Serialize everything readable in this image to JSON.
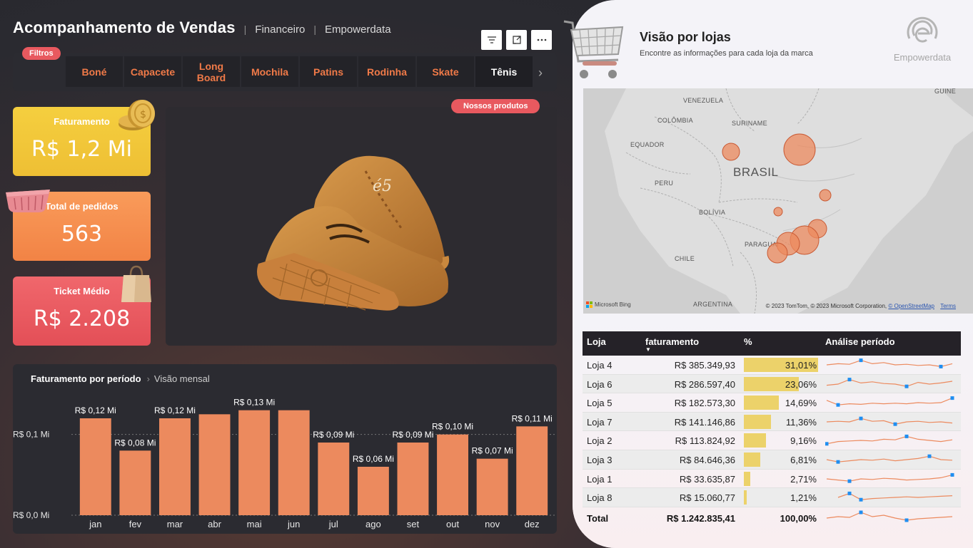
{
  "header": {
    "title": "Acompanhamento de Vendas",
    "crumbs": [
      "Financeiro",
      "Empowerdata"
    ]
  },
  "filters": {
    "badge": "Filtros",
    "items": [
      "Boné",
      "Capacete",
      "Long Board",
      "Mochila",
      "Patins",
      "Rodinha",
      "Skate",
      "Tênis"
    ],
    "selected": "Tênis"
  },
  "kpis": {
    "faturamento": {
      "label": "Faturamento",
      "value": "R$ 1,2 Mi"
    },
    "pedidos": {
      "label": "Total de pedidos",
      "value": "563"
    },
    "ticket": {
      "label": "Ticket Médio",
      "value": "R$ 2.208"
    }
  },
  "products": {
    "badge": "Nossos produtos"
  },
  "chart_title": {
    "title": "Faturamento por período",
    "subtitle": "Visão mensal"
  },
  "chart_data": {
    "type": "bar",
    "categories": [
      "jan",
      "fev",
      "mar",
      "abr",
      "mai",
      "jun",
      "jul",
      "ago",
      "set",
      "out",
      "nov",
      "dez"
    ],
    "values": [
      0.12,
      0.08,
      0.12,
      0.125,
      0.13,
      0.13,
      0.09,
      0.06,
      0.09,
      0.1,
      0.07,
      0.11
    ],
    "data_labels": [
      "R$ 0,12 Mi",
      "R$ 0,08 Mi",
      "R$ 0,12 Mi",
      "",
      "R$ 0,13 Mi",
      "",
      "R$ 0,09 Mi",
      "R$ 0,06 Mi",
      "R$ 0,09 Mi",
      "R$ 0,10 Mi",
      "R$ 0,07 Mi",
      "R$ 0,11 Mi"
    ],
    "y_ticks": [
      {
        "value": 0,
        "label": "R$ 0,0 Mi"
      },
      {
        "value": 0.1,
        "label": "R$ 0,1 Mi"
      }
    ],
    "ylim": [
      0,
      0.135
    ],
    "color": "#ec8a5e",
    "grid": true
  },
  "right": {
    "title": "Visão por lojas",
    "subtitle": "Encontre as informações para cada loja da marca",
    "brand": "Empowerdata"
  },
  "map": {
    "labels": [
      "VENEZUELA",
      "GUINE",
      "COLÔMBIA",
      "SURINAME",
      "EQUADOR",
      "BRASIL",
      "PERU",
      "BOLÍVIA",
      "PARAGUAI",
      "CHILE",
      "ARGENTINA"
    ],
    "credit": "© 2023 TomTom, © 2023 Microsoft Corporation,",
    "osm": "© OpenStreetMap",
    "terms": "Terms",
    "bing": "Microsoft Bing"
  },
  "table": {
    "headers": {
      "loja": "Loja",
      "faturamento": "faturamento",
      "pct": "%",
      "analise": "Análise período"
    },
    "rows": [
      {
        "loja": "Loja 4",
        "faturamento": "R$ 385.349,93",
        "pct": "31,01%",
        "share": 0.3101,
        "trend": [
          0.5,
          0.6,
          0.55,
          0.9,
          0.6,
          0.7,
          0.5,
          0.55,
          0.45,
          0.5,
          0.35,
          0.6
        ]
      },
      {
        "loja": "Loja 6",
        "faturamento": "R$ 286.597,40",
        "pct": "23,06%",
        "share": 0.2306,
        "trend": [
          0.4,
          0.5,
          0.9,
          0.6,
          0.7,
          0.55,
          0.5,
          0.3,
          0.65,
          0.5,
          0.6,
          0.75
        ]
      },
      {
        "loja": "Loja 5",
        "faturamento": "R$ 182.573,30",
        "pct": "14,69%",
        "share": 0.1469,
        "trend": [
          0.7,
          0.3,
          0.4,
          0.35,
          0.45,
          0.4,
          0.45,
          0.4,
          0.5,
          0.45,
          0.5,
          0.9
        ]
      },
      {
        "loja": "Loja 7",
        "faturamento": "R$ 141.146,86",
        "pct": "11,36%",
        "share": 0.1136,
        "trend": [
          0.5,
          0.55,
          0.5,
          0.8,
          0.55,
          0.6,
          0.3,
          0.5,
          0.55,
          0.45,
          0.5,
          0.4
        ]
      },
      {
        "loja": "Loja 2",
        "faturamento": "R$ 113.824,92",
        "pct": "9,16%",
        "share": 0.0916,
        "trend": [
          0.2,
          0.4,
          0.45,
          0.5,
          0.45,
          0.6,
          0.55,
          0.85,
          0.6,
          0.5,
          0.4,
          0.55
        ]
      },
      {
        "loja": "Loja 3",
        "faturamento": "R$ 84.646,36",
        "pct": "6,81%",
        "share": 0.0681,
        "trend": [
          0.5,
          0.3,
          0.4,
          0.5,
          0.45,
          0.55,
          0.4,
          0.5,
          0.6,
          0.8,
          0.5,
          0.45
        ]
      },
      {
        "loja": "Loja 1",
        "faturamento": "R$ 33.635,87",
        "pct": "2,71%",
        "share": 0.0271,
        "trend": [
          0.5,
          0.4,
          0.3,
          0.5,
          0.45,
          0.55,
          0.5,
          0.4,
          0.45,
          0.5,
          0.6,
          0.85
        ]
      },
      {
        "loja": "Loja 8",
        "faturamento": "R$ 15.060,77",
        "pct": "1,21%",
        "share": 0.0121,
        "trend": [
          null,
          0.5,
          0.85,
          0.3,
          0.4,
          0.45,
          0.5,
          0.55,
          0.5,
          0.55,
          0.6,
          0.65
        ]
      }
    ],
    "total": {
      "loja": "Total",
      "faturamento": "R$ 1.242.835,41",
      "pct": "100,00%",
      "trend": [
        0.5,
        0.6,
        0.55,
        0.9,
        0.6,
        0.7,
        0.5,
        0.35,
        0.45,
        0.5,
        0.55,
        0.6
      ]
    }
  }
}
